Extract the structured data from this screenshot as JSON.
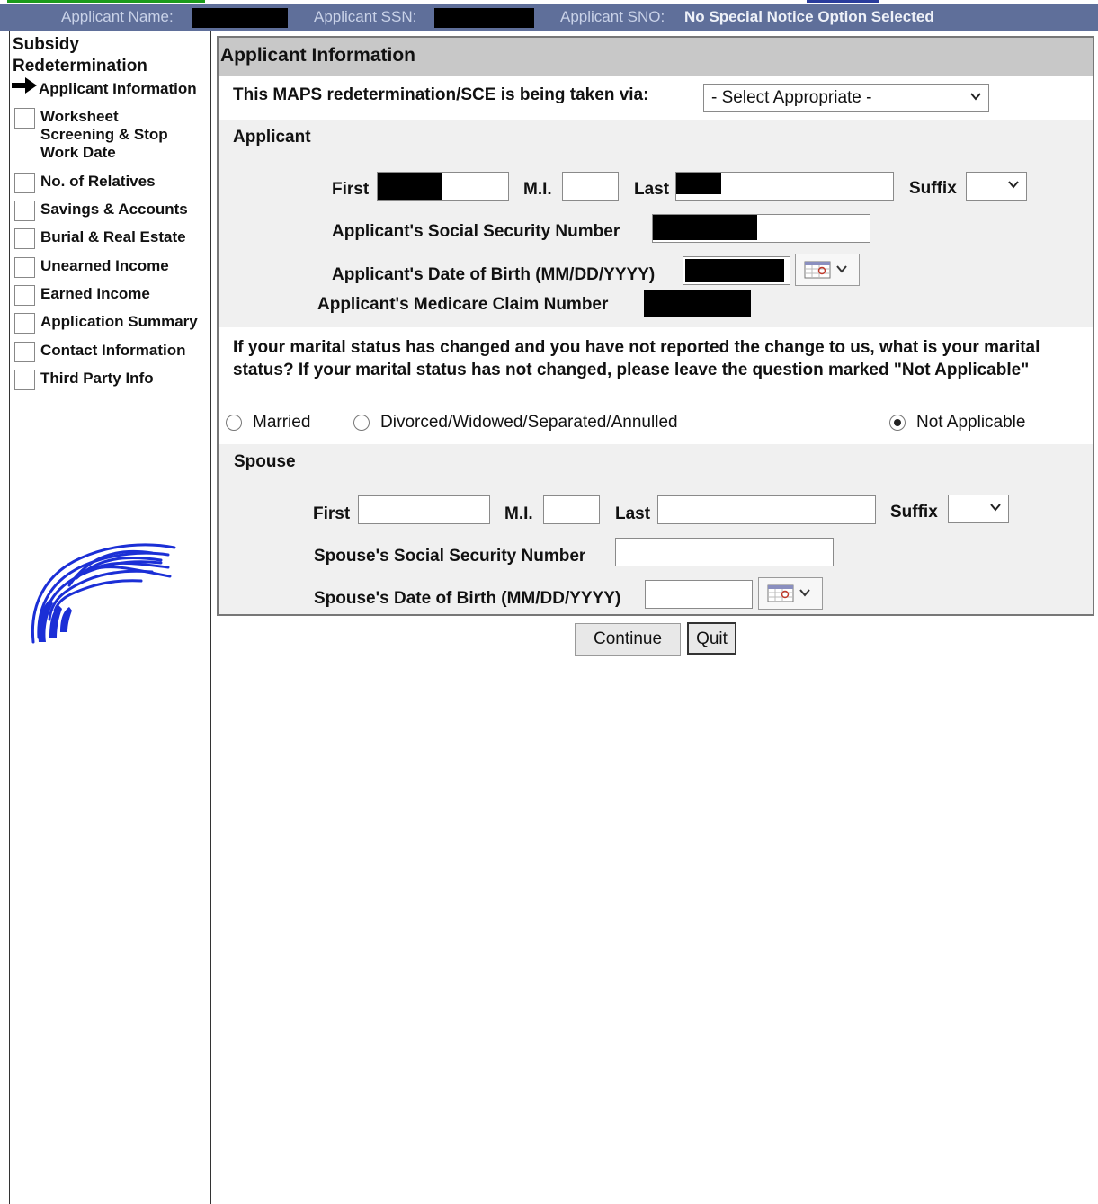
{
  "header": {
    "applicant_name_label": "Applicant Name:",
    "applicant_ssn_label": "Applicant SSN:",
    "applicant_sno_label": "Applicant SNO:",
    "applicant_sno_value": "No Special Notice Option Selected"
  },
  "sidebar": {
    "title_line1": "Subsidy",
    "title_line2": "Redetermination",
    "current": "Applicant Information",
    "items": [
      {
        "label_line1": "Worksheet",
        "label_line2": "Screening & Stop",
        "label_line3": "Work Date"
      },
      {
        "label_line1": "No. of Relatives"
      },
      {
        "label_line1": "Savings & Accounts"
      },
      {
        "label_line1": "Burial & Real Estate"
      },
      {
        "label_line1": "Unearned Income"
      },
      {
        "label_line1": "Earned Income"
      },
      {
        "label_line1": "Application Summary"
      },
      {
        "label_line1": "Contact Information"
      },
      {
        "label_line1": "Third Party Info"
      }
    ]
  },
  "panel": {
    "title": "Applicant Information",
    "via_question": "This MAPS redetermination/SCE is being taken via:",
    "via_select_value": "- Select Appropriate -",
    "applicant_section": "Applicant",
    "first_label": "First",
    "mi_label": "M.I.",
    "last_label": "Last",
    "suffix_label": "Suffix",
    "ssn_label": "Applicant's Social Security Number",
    "dob_label": "Applicant's Date of Birth (MM/DD/YYYY)",
    "medicare_label": "Applicant's Medicare Claim Number",
    "marital_question": "If your marital status has changed and you have not reported the change to us, what is your marital status? If your marital status has not changed, please leave the question marked \"Not Applicable\"",
    "marital_options": [
      "Married",
      "Divorced/Widowed/Separated/Annulled",
      "Not Applicable"
    ],
    "marital_selected": "Not Applicable",
    "spouse_section": "Spouse",
    "spouse_first_label": "First",
    "spouse_mi_label": "M.I.",
    "spouse_last_label": "Last",
    "spouse_suffix_label": "Suffix",
    "spouse_ssn_label": "Spouse's Social Security Number",
    "spouse_dob_label": "Spouse's Date of Birth (MM/DD/YYYY)"
  },
  "buttons": {
    "continue": "Continue",
    "quit": "Quit"
  },
  "icons": {
    "calendar": "calendar-icon",
    "chevron": "chevron-down-icon",
    "arrow": "arrow-right-icon",
    "logo": "eagle-logo"
  }
}
